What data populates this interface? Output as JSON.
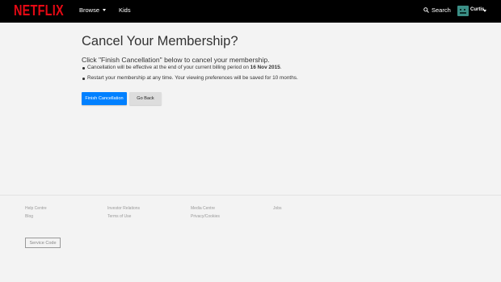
{
  "header": {
    "logo": "NETFLIX",
    "nav": {
      "browse": "Browse",
      "kids": "Kids"
    },
    "search": {
      "icon": "search-icon",
      "label": "Search"
    },
    "profile": {
      "name": "Curtis",
      "avatar_color": "#3b8f86"
    },
    "brand_color": "#e50914"
  },
  "main": {
    "title": "Cancel Your Membership?",
    "intro": "Click \"Finish Cancellation\" below to cancel your membership.",
    "bullet1_prefix": "Cancellation will be effective at the end of your current billing period on ",
    "bullet1_date": "16 Nov 2015",
    "bullet1_suffix": ".",
    "bullet2": "Restart your membership at any time. Your viewing preferences will be saved for 10 months.",
    "finish_label": "Finish Cancellation",
    "back_label": "Go Back",
    "accent_color": "#0080ff"
  },
  "footer": {
    "links": [
      [
        "Help Centre",
        "Blog"
      ],
      [
        "Investor Relations",
        "Terms of Use"
      ],
      [
        "Media Centre",
        "Privacy/Cookies"
      ],
      [
        "Jobs"
      ]
    ],
    "service_code": "Service Code"
  }
}
